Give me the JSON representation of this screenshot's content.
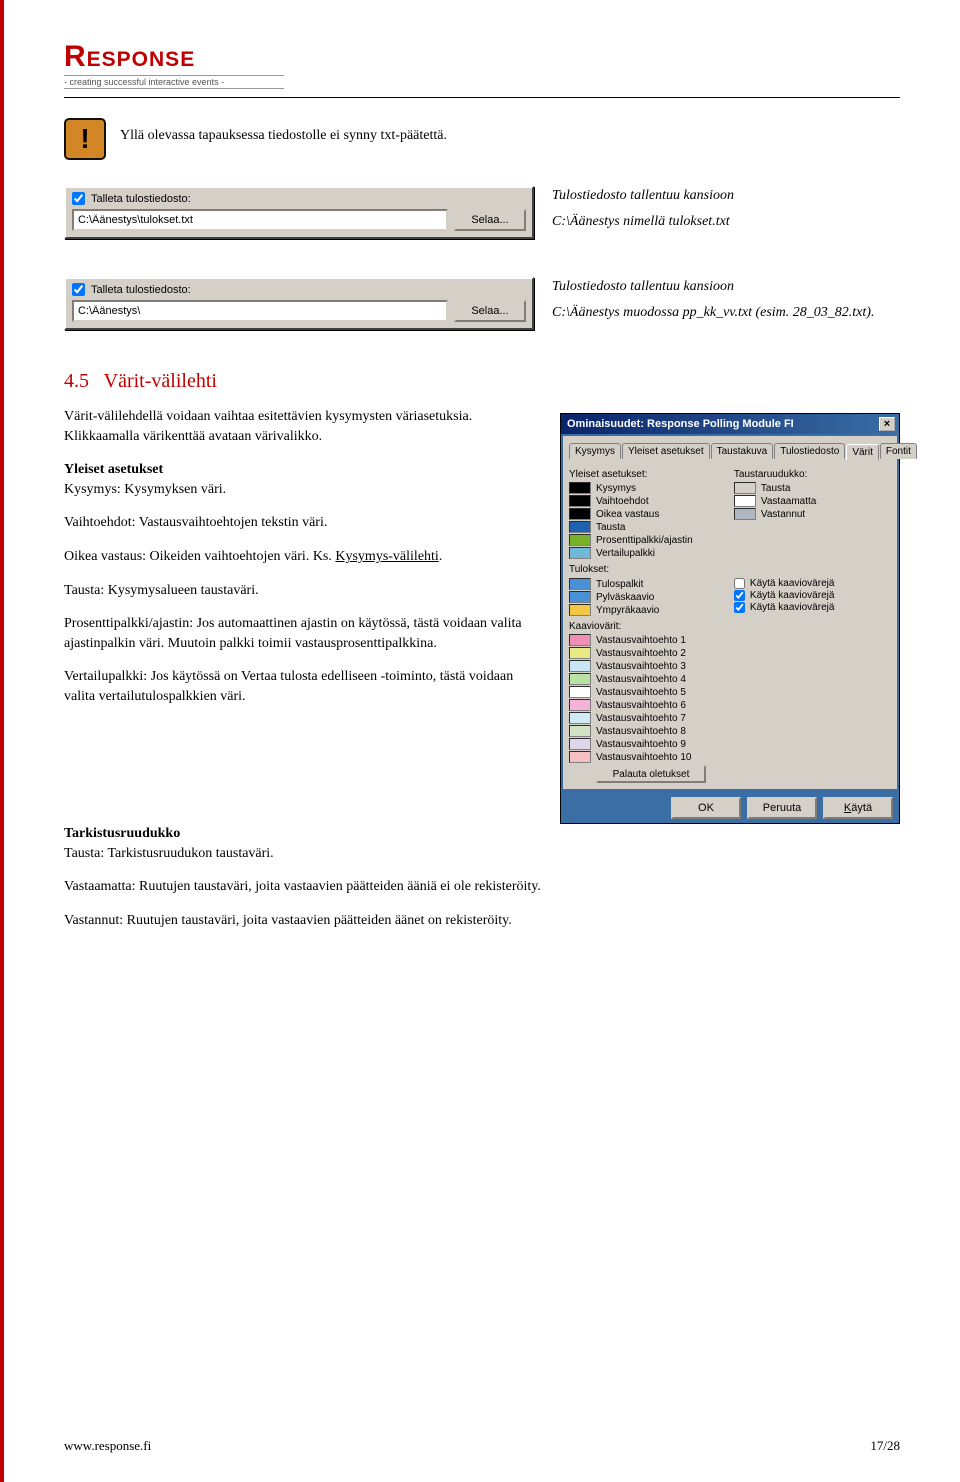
{
  "logo": {
    "text": "Response",
    "tagline": "- creating successful interactive events -"
  },
  "warning": {
    "text": "Yllä olevassa tapauksessa tiedostolle ei synny txt-päätettä."
  },
  "panel1": {
    "checkbox_label": "Talleta tulostiedosto:",
    "path": "C:\\Äänestys\\tulokset.txt",
    "browse": "Selaa...",
    "note1": "Tulostiedosto tallentuu kansioon",
    "note2": "C:\\Äänestys nimellä tulokset.txt"
  },
  "panel2": {
    "checkbox_label": "Talleta tulostiedosto:",
    "path": "C:\\Äänestys\\",
    "browse": "Selaa...",
    "note1": "Tulostiedosto tallentuu kansioon",
    "note2": "C:\\Äänestys muodossa pp_kk_vv.txt (esim. 28_03_82.txt)."
  },
  "section": {
    "number": "4.5",
    "title": "Värit-välilehti",
    "intro": "Värit-välilehdellä voidaan vaihtaa esitettävien kysymysten väriasetuksia. Klikkaamalla värikenttää avataan värivalikko.",
    "yleiset_h": "Yleiset asetukset",
    "kysymys": "Kysymys: Kysymyksen väri.",
    "vaihtoehdot": "Vaihtoehdot: Vastausvaihtoehtojen tekstin väri.",
    "oikea_pre": "Oikea vastaus: Oikeiden vaihtoehtojen väri. Ks. ",
    "oikea_link": "Kysymys-välilehti",
    "tausta": "Tausta: Kysymysalueen taustaväri.",
    "prosentti": "Prosenttipalkki/ajastin: Jos automaattinen ajastin on käytössä, tästä voidaan valita ajastinpalkin väri. Muutoin palkki toimii vastausprosenttipalkkina.",
    "vertailu": "Vertailupalkki: Jos käytössä on Vertaa tulosta edelliseen -toiminto, tästä voidaan valita vertailutulospalkkien väri.",
    "tarkistus_h": "Tarkistusruudukko",
    "tarkistus_tausta": "Tausta: Tarkistusruudukon taustaväri.",
    "vastaamatta": "Vastaamatta: Ruutujen taustaväri, joita vastaavien päätteiden ääniä ei ole rekisteröity.",
    "vastannut": "Vastannut: Ruutujen taustaväri, joita vastaavien päätteiden äänet on rekisteröity."
  },
  "dialog": {
    "title": "Ominaisuudet: Response Polling Module FI",
    "tabs": [
      "Kysymys",
      "Yleiset asetukset",
      "Taustakuva",
      "Tulostiedosto",
      "Värit",
      "Fontit"
    ],
    "active_tab": "Värit",
    "group_yleiset": "Yleiset asetukset:",
    "left_items": [
      "Kysymys",
      "Vaihtoehdot",
      "Oikea vastaus",
      "Tausta",
      "Prosenttipalkki/ajastin",
      "Vertailupalkki"
    ],
    "group_tausta": "Taustaruudukko:",
    "right_items": [
      "Tausta",
      "Vastaamatta",
      "Vastannut"
    ],
    "group_tulokset": "Tulokset:",
    "tulokset_left": [
      "Tulospalkit",
      "Pylväskaavio",
      "Ympyräkaavio"
    ],
    "tulokset_right": [
      "Käytä kaaviovärejä",
      "Käytä kaaviovärejä",
      "Käytä kaaviovärejä"
    ],
    "group_kaavio": "Kaaviovärit:",
    "kaavio_items": [
      "Vastausvaihtoehto 1",
      "Vastausvaihtoehto 2",
      "Vastausvaihtoehto 3",
      "Vastausvaihtoehto 4",
      "Vastausvaihtoehto 5",
      "Vastausvaihtoehto 6",
      "Vastausvaihtoehto 7",
      "Vastausvaihtoehto 8",
      "Vastausvaihtoehto 9",
      "Vastausvaihtoehto 10"
    ],
    "reset": "Palauta oletukset",
    "ok": "OK",
    "cancel": "Peruuta",
    "apply": "Käytä"
  },
  "footer": {
    "url": "www.response.fi",
    "page": "17/28"
  },
  "colors": {
    "yleiset": [
      "#000000",
      "#000000",
      "#000000",
      "#1e62b0",
      "#78b028",
      "#6fb8d8"
    ],
    "tausta": [
      "#d4d0c8",
      "#ffffff",
      "#aeb6bf"
    ],
    "tulokset": [
      "#4a90d6",
      "#4a90d6",
      "#f2c744"
    ],
    "kaavio": [
      "#ef8fb5",
      "#e9ea85",
      "#c9e6f5",
      "#b9e3a3",
      "#ffffff",
      "#f7b2d9",
      "#cfeaf4",
      "#d0e3c4",
      "#e0d7ef",
      "#f7c0c0"
    ]
  }
}
